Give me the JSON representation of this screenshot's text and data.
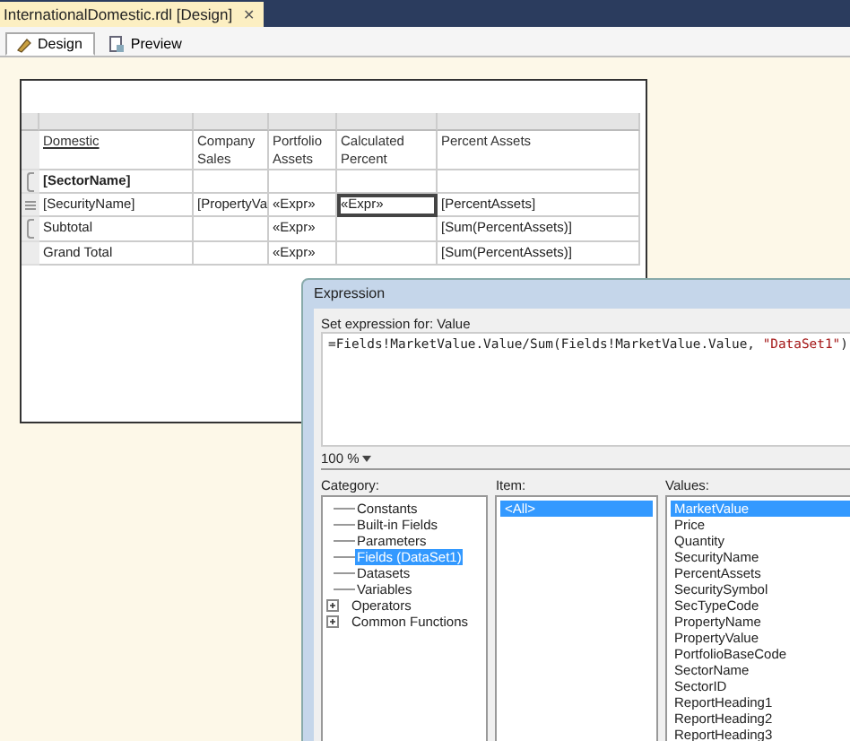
{
  "document_tab": {
    "title": "InternationalDomestic.rdl [Design]",
    "close": "✕"
  },
  "view_tabs": [
    {
      "label": "Design",
      "selected": true
    },
    {
      "label": "Preview",
      "selected": false
    }
  ],
  "table": {
    "columns": [
      "Domestic",
      "Company Sales",
      "Portfolio Assets",
      "Calculated Percent",
      "Percent Assets"
    ],
    "rows": [
      {
        "kind": "group",
        "cells": [
          {
            "text": "[SectorName]",
            "selected": false
          },
          {
            "selected": false
          },
          {
            "selected": false
          },
          {
            "selected": false
          },
          {
            "selected": false
          }
        ]
      },
      {
        "kind": "detail",
        "cells": [
          {
            "text": "[SecurityName]",
            "selected": false
          },
          {
            "text": "[PropertyVa",
            "selected": false
          },
          {
            "text": "«Expr»",
            "selected": false
          },
          {
            "text": "«Expr»",
            "selected": true
          },
          {
            "text": "[PercentAssets]",
            "selected": false
          }
        ]
      },
      {
        "kind": "subtotal",
        "cells": [
          {
            "text": "Subtotal",
            "selected": false
          },
          {
            "selected": false
          },
          {
            "text": "«Expr»",
            "selected": false
          },
          {
            "selected": false
          },
          {
            "text": "[Sum(PercentAssets)]",
            "selected": false
          }
        ]
      },
      {
        "kind": "total",
        "cells": [
          {
            "text": "Grand Total",
            "selected": false
          },
          {
            "selected": false
          },
          {
            "text": "«Expr»",
            "selected": false
          },
          {
            "selected": false
          },
          {
            "text": "[Sum(PercentAssets)]",
            "selected": false
          }
        ]
      }
    ]
  },
  "dialog": {
    "title": "Expression",
    "prompt": "Set expression for: Value",
    "expression": {
      "code": "=Fields!MarketValue.Value/Sum(Fields!MarketValue.Value, ",
      "literal": "\"DataSet1\"",
      "end": ")"
    },
    "zoom": "100 %",
    "category": {
      "label": "Category:",
      "items": [
        {
          "label": "Constants",
          "selected": false,
          "expandable": false
        },
        {
          "label": "Built-in Fields",
          "selected": false,
          "expandable": false
        },
        {
          "label": "Parameters",
          "selected": false,
          "expandable": false
        },
        {
          "label": "Fields (DataSet1)",
          "selected": true,
          "expandable": false
        },
        {
          "label": "Datasets",
          "selected": false,
          "expandable": false
        },
        {
          "label": "Variables",
          "selected": false,
          "expandable": false
        },
        {
          "label": "Operators",
          "selected": false,
          "expandable": true
        },
        {
          "label": "Common Functions",
          "selected": false,
          "expandable": true
        }
      ]
    },
    "item": {
      "label": "Item:",
      "items": [
        {
          "label": "<All>",
          "selected": true
        }
      ]
    },
    "values": {
      "label": "Values:",
      "items": [
        {
          "label": "MarketValue",
          "selected": true
        },
        {
          "label": "Price",
          "selected": false
        },
        {
          "label": "Quantity",
          "selected": false
        },
        {
          "label": "SecurityName",
          "selected": false
        },
        {
          "label": "PercentAssets",
          "selected": false
        },
        {
          "label": "SecuritySymbol",
          "selected": false
        },
        {
          "label": "SecTypeCode",
          "selected": false
        },
        {
          "label": "PropertyName",
          "selected": false
        },
        {
          "label": "PropertyValue",
          "selected": false
        },
        {
          "label": "PortfolioBaseCode",
          "selected": false
        },
        {
          "label": "SectorName",
          "selected": false
        },
        {
          "label": "SectorID",
          "selected": false
        },
        {
          "label": "ReportHeading1",
          "selected": false
        },
        {
          "label": "ReportHeading2",
          "selected": false
        },
        {
          "label": "ReportHeading3",
          "selected": false
        }
      ]
    }
  }
}
